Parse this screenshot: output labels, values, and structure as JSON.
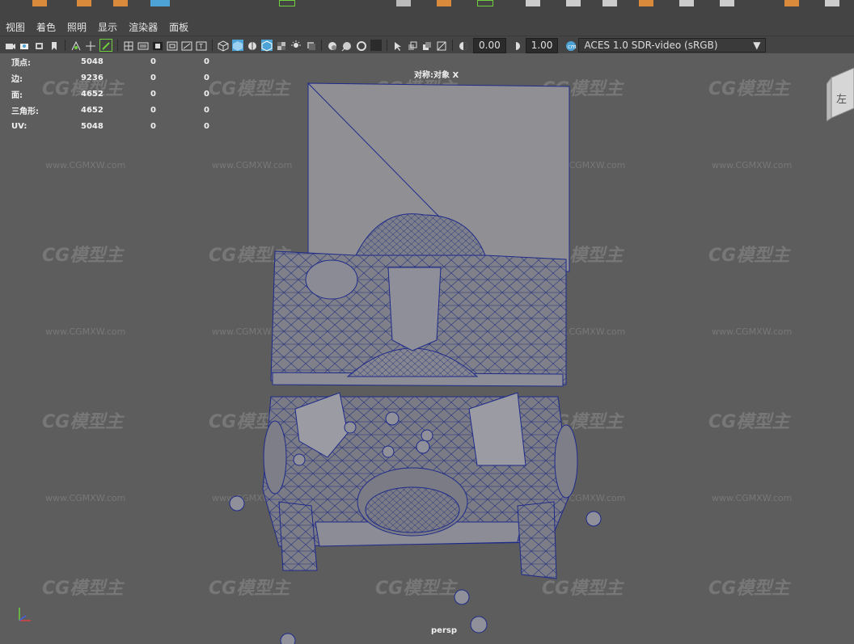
{
  "menu": [
    "视图",
    "着色",
    "照明",
    "显示",
    "渲染器",
    "面板"
  ],
  "toolbar": {
    "gamma_value": "0.00",
    "exposure_value": "1.00",
    "color_space": "ACES 1.0 SDR-video (sRGB)"
  },
  "hud": {
    "rows": [
      {
        "label": "顶点:",
        "v1": "5048",
        "v2": "0",
        "v3": "0"
      },
      {
        "label": "边:",
        "v1": "9236",
        "v2": "0",
        "v3": "0"
      },
      {
        "label": "面:",
        "v1": "4652",
        "v2": "0",
        "v3": "0"
      },
      {
        "label": "三角形:",
        "v1": "4652",
        "v2": "0",
        "v3": "0"
      },
      {
        "label": "UV:",
        "v1": "5048",
        "v2": "0",
        "v3": "0"
      }
    ]
  },
  "symmetry_label": "对称:对象 X",
  "camera_label": "persp",
  "viewcube_label": "左",
  "watermark": {
    "logo": "CG模型主",
    "url": "www.CGMXW.com"
  },
  "colors": {
    "accent": "#4ea3d6",
    "toolbar_bg": "#444444",
    "viewport_bg": "#5d5d5d",
    "wire": "#1e2a8a"
  }
}
